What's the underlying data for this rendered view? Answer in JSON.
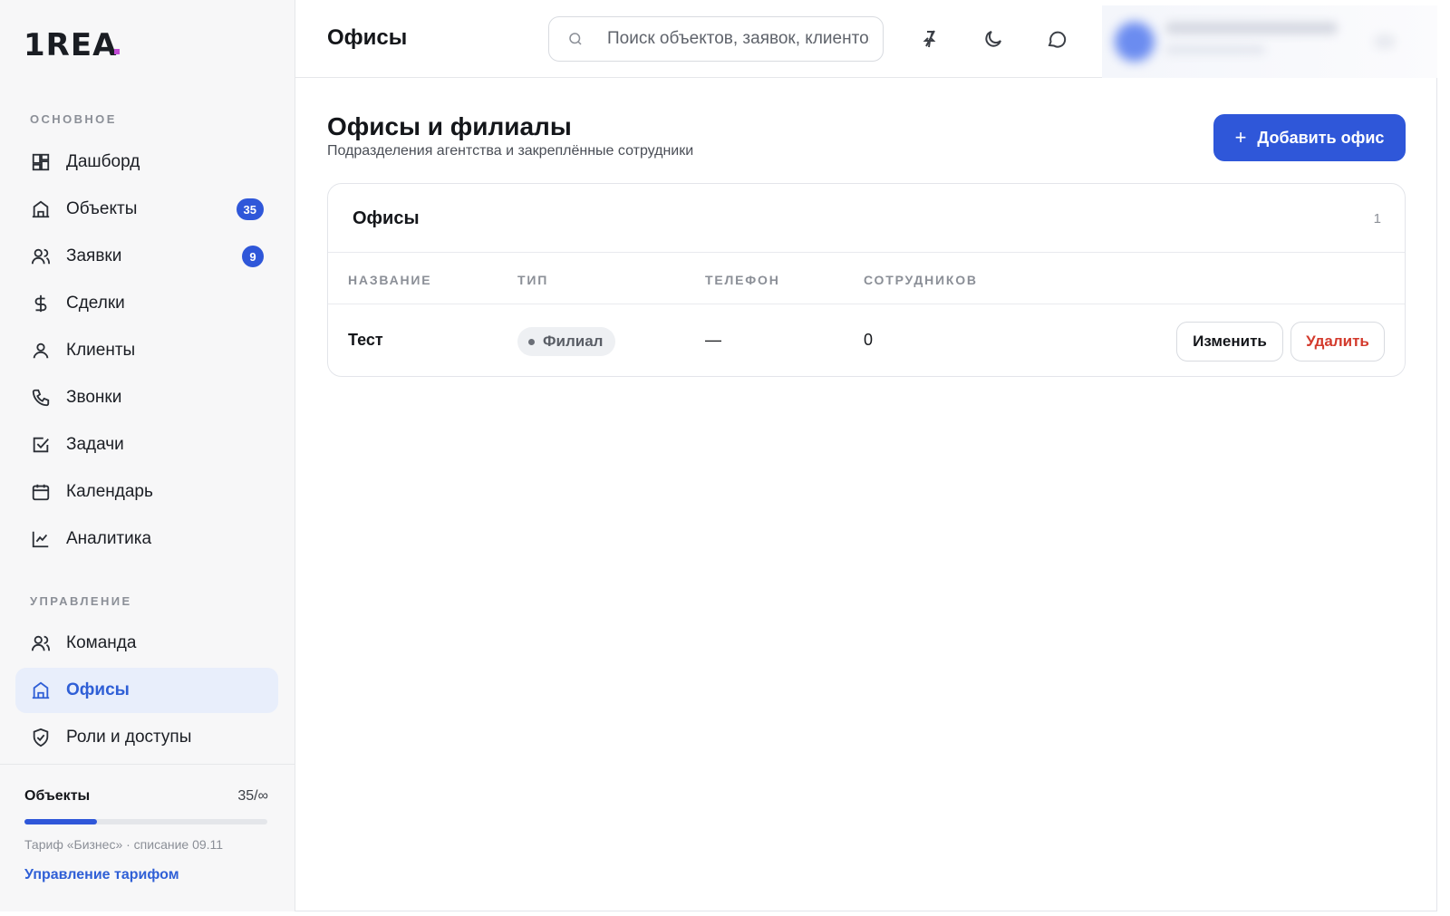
{
  "colors": {
    "accent": "#2f57d9",
    "danger": "#d33a2c",
    "sidebar_bg": "#f7f7f8"
  },
  "logo": {
    "text": "1REA"
  },
  "sidebar": {
    "section_main": "ОСНОВНОЕ",
    "section_manage": "УПРАВЛЕНИЕ",
    "items": [
      {
        "label": "Дашборд",
        "icon": "dashboard-icon"
      },
      {
        "label": "Объекты",
        "icon": "building-icon",
        "badge": "35"
      },
      {
        "label": "Заявки",
        "icon": "users-icon",
        "badge": "9"
      },
      {
        "label": "Сделки",
        "icon": "dollar-icon"
      },
      {
        "label": "Клиенты",
        "icon": "user-icon"
      },
      {
        "label": "Звонки",
        "icon": "phone-icon"
      },
      {
        "label": "Задачи",
        "icon": "checkbox-icon"
      },
      {
        "label": "Календарь",
        "icon": "calendar-icon"
      },
      {
        "label": "Аналитика",
        "icon": "chart-line-icon"
      },
      {
        "label": "Команда",
        "icon": "team-icon"
      },
      {
        "label": "Офисы",
        "icon": "office-icon",
        "active": true
      },
      {
        "label": "Роли и доступы",
        "icon": "shield-check-icon"
      }
    ],
    "plan": {
      "title": "Объекты",
      "count": "35/∞",
      "progress": 0.3,
      "note": "Тариф «Бизнес» · списание 09.11",
      "link": "Управление тарифом"
    }
  },
  "header": {
    "title": "Офисы",
    "search_placeholder": "Поиск объектов, заявок, клиентов",
    "icons": [
      "pin-off-icon",
      "moon-icon",
      "chat-icon"
    ]
  },
  "main": {
    "title": "Офисы и филиалы",
    "subtitle": "Подразделения агентства и закреплённые сотрудники",
    "add_button": "Добавить офис",
    "card": {
      "title": "Офисы",
      "count": "1",
      "columns": [
        "НАЗВАНИЕ",
        "ТИП",
        "ТЕЛЕФОН",
        "СОТРУДНИКОВ"
      ],
      "rows": [
        {
          "name": "Тест",
          "type": "Филиал",
          "phone": "—",
          "employees": "0",
          "edit": "Изменить",
          "delete": "Удалить"
        }
      ]
    }
  }
}
